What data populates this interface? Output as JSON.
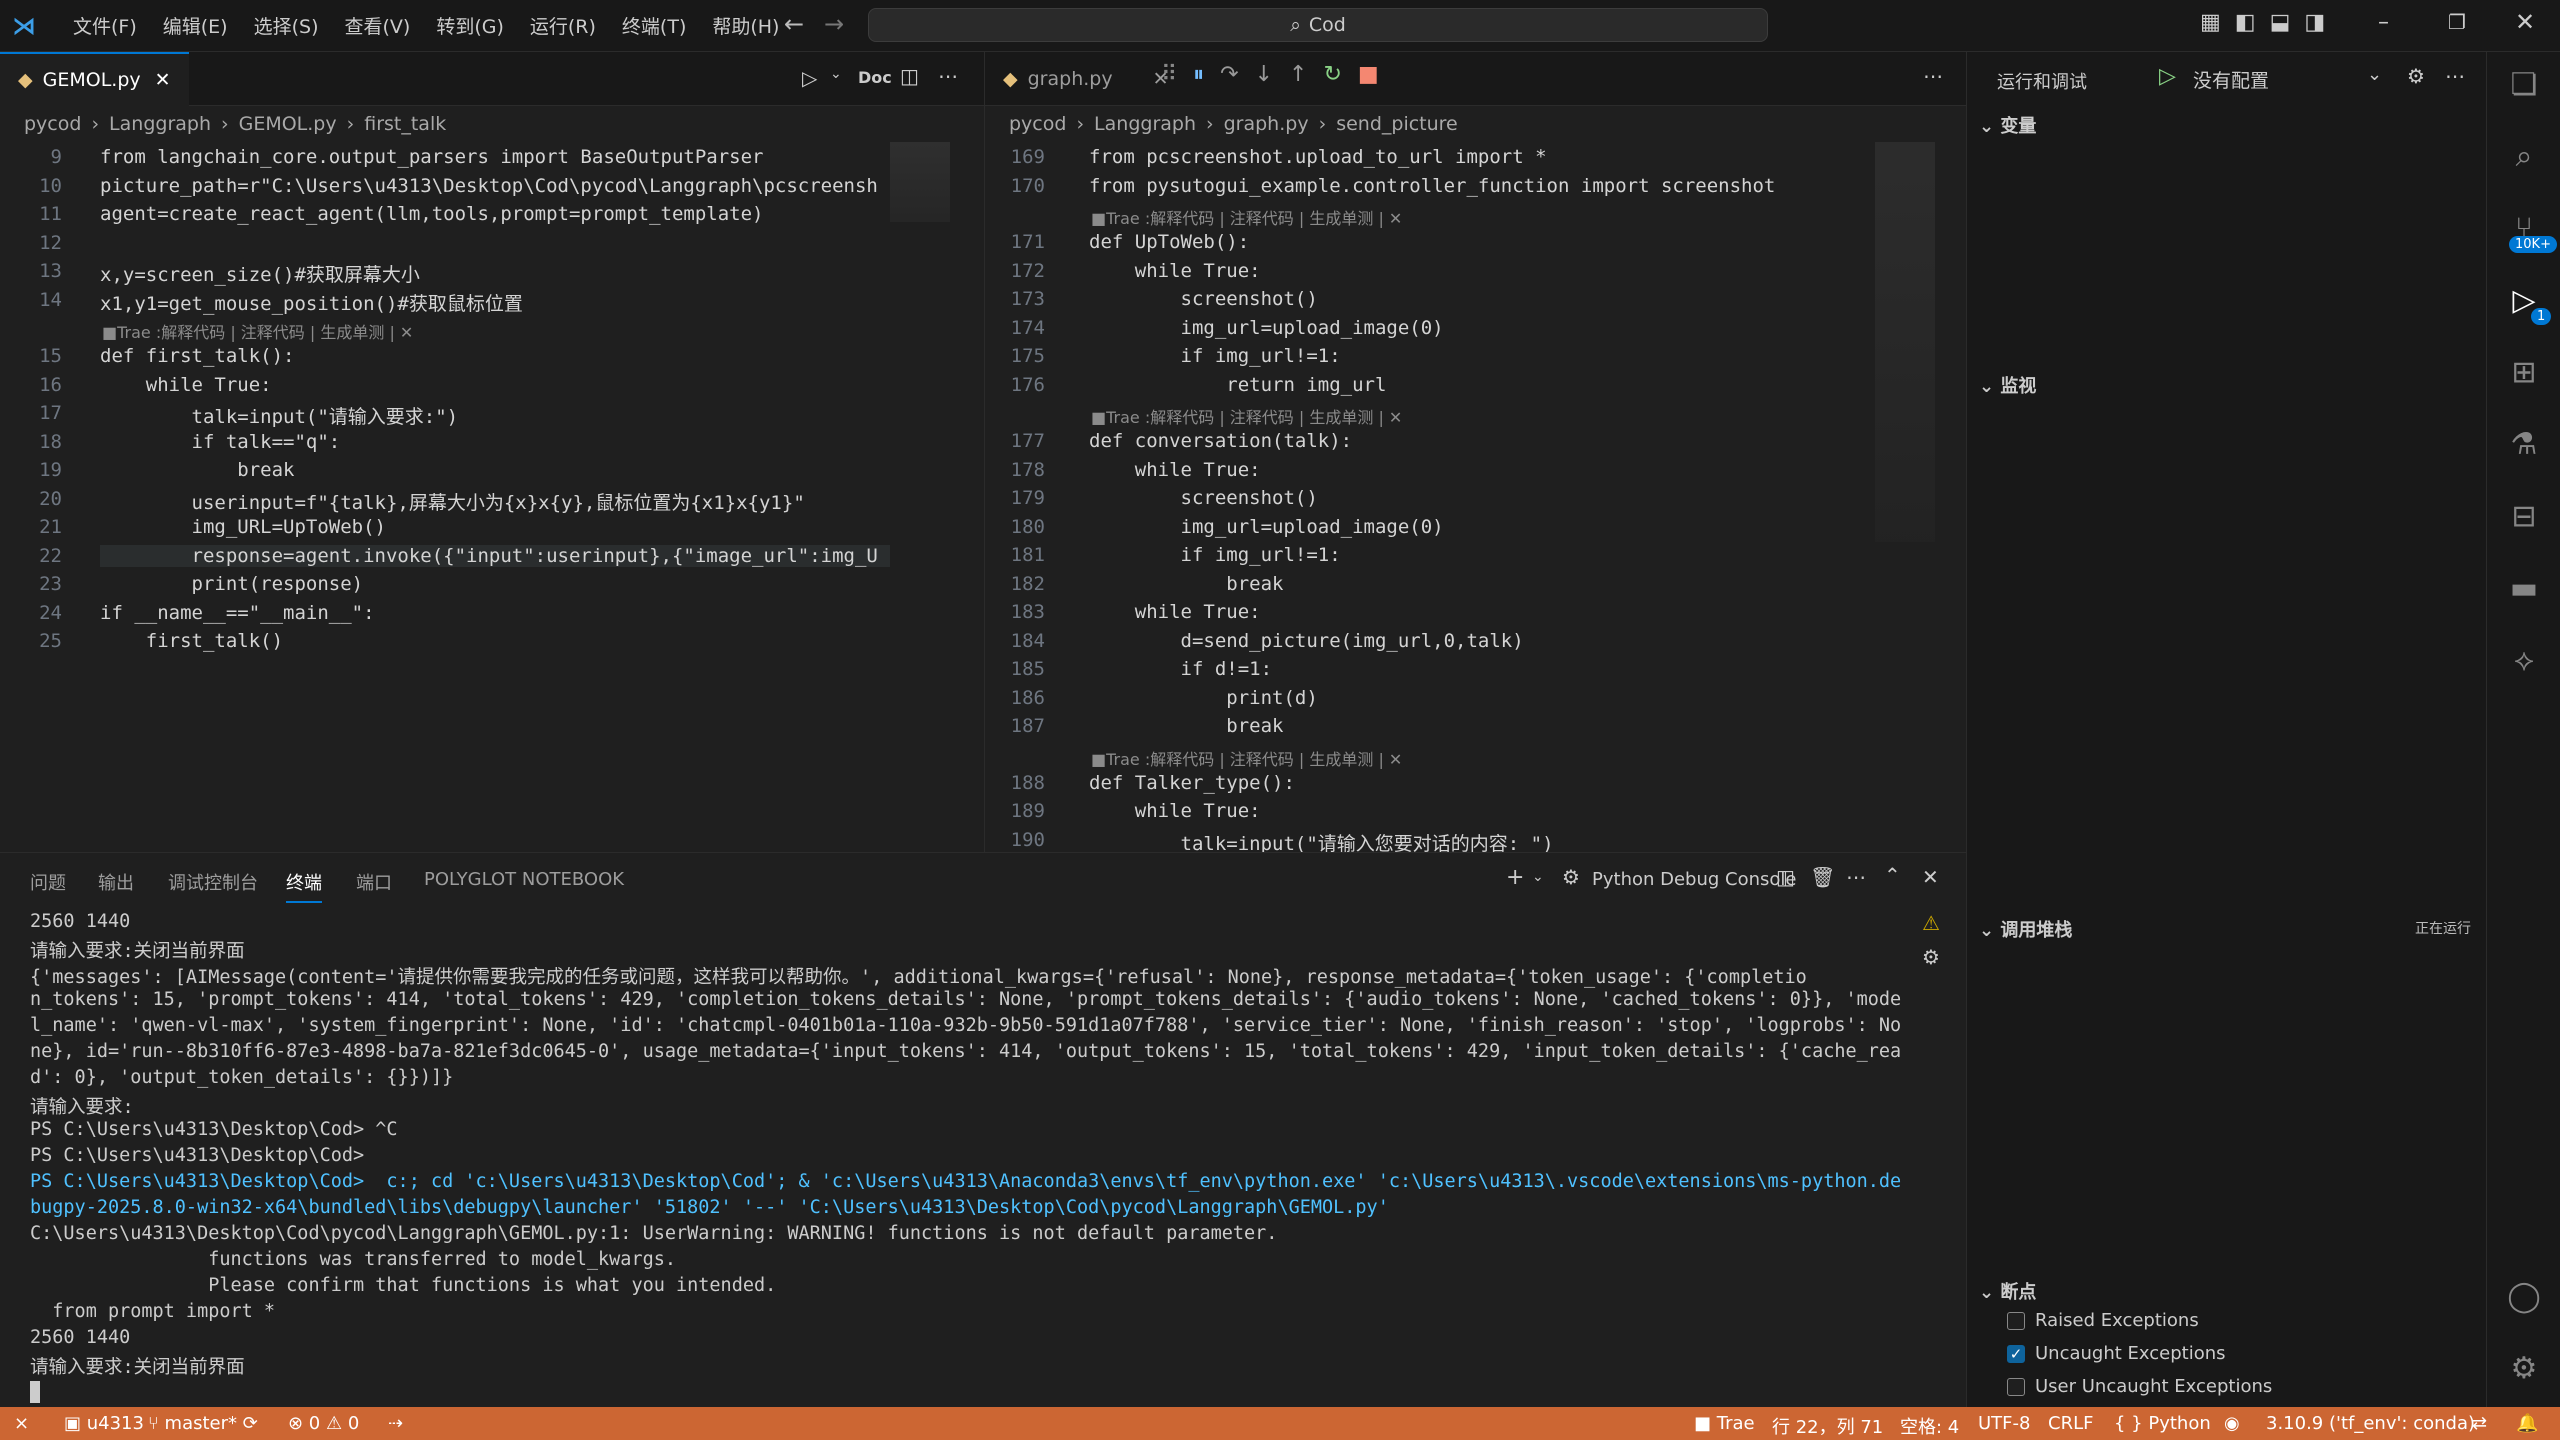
{
  "menu": [
    "文件(F)",
    "编辑(E)",
    "选择(S)",
    "查看(V)",
    "转到(G)",
    "运行(R)",
    "终端(T)",
    "帮助(H)"
  ],
  "search": "Cod",
  "left": {
    "tab": "GEMOL.py",
    "doc": "Doc",
    "crumbs": [
      "pycod",
      "Langgraph",
      "GEMOL.py",
      "first_talk"
    ],
    "lines": [
      [
        "9",
        "from langchain_core.output_parsers import BaseOutputParser"
      ],
      [
        "10",
        "picture_path=r\"C:\\Users\\u4313\\Desktop\\Cod\\pycod\\Langgraph\\pcscreensh"
      ],
      [
        "11",
        "agent=create_react_agent(llm,tools,prompt=prompt_template)"
      ],
      [
        "12",
        ""
      ],
      [
        "13",
        "x,y=screen_size()#获取屏幕大小"
      ],
      [
        "14",
        "x1,y1=get_mouse_position()#获取鼠标位置"
      ],
      [
        "15",
        "def first_talk():"
      ],
      [
        "16",
        "    while True:"
      ],
      [
        "17",
        "        talk=input(\"请输入要求:\")"
      ],
      [
        "18",
        "        if talk==\"q\":"
      ],
      [
        "19",
        "            break"
      ],
      [
        "20",
        "        userinput=f\"{talk},屏幕大小为{x}x{y},鼠标位置为{x1}x{y1}\""
      ],
      [
        "21",
        "        img_URL=UpToWeb()"
      ],
      [
        "22",
        "        response=agent.invoke({\"input\":userinput},{\"image_url\":img_U"
      ],
      [
        "23",
        "        print(response)"
      ],
      [
        "24",
        "if __name__==\"__main__\":"
      ],
      [
        "25",
        "    first_talk()"
      ]
    ],
    "lens": "■Trae :解释代码 | 注释代码 | 生成单测 | ✕"
  },
  "right": {
    "tab": "graph.py",
    "crumbs": [
      "pycod",
      "Langgraph",
      "graph.py",
      "send_picture"
    ],
    "lines": [
      [
        "169",
        "from pcscreenshot.upload_to_url import *"
      ],
      [
        "170",
        "from pysutogui_example.controller_function import screenshot"
      ],
      [
        "171",
        "def UpToWeb():"
      ],
      [
        "172",
        "    while True:"
      ],
      [
        "173",
        "        screenshot()"
      ],
      [
        "174",
        "        img_url=upload_image(0)"
      ],
      [
        "175",
        "        if img_url!=1:"
      ],
      [
        "176",
        "            return img_url"
      ],
      [
        "177",
        "def conversation(talk):"
      ],
      [
        "178",
        "    while True:"
      ],
      [
        "179",
        "        screenshot()"
      ],
      [
        "180",
        "        img_url=upload_image(0)"
      ],
      [
        "181",
        "        if img_url!=1:"
      ],
      [
        "182",
        "            break"
      ],
      [
        "183",
        "    while True:"
      ],
      [
        "184",
        "        d=send_picture(img_url,0,talk)"
      ],
      [
        "185",
        "        if d!=1:"
      ],
      [
        "186",
        "            print(d)"
      ],
      [
        "187",
        "            break"
      ],
      [
        "188",
        "def Talker_type():"
      ],
      [
        "189",
        "    while True:"
      ],
      [
        "190",
        "        talk=input(\"请输入您要对话的内容: \")"
      ]
    ]
  },
  "panel": {
    "tabs": [
      "问题",
      "输出",
      "调试控制台",
      "终端",
      "端口",
      "POLYGLOT NOTEBOOK"
    ],
    "console": "Python Debug Console",
    "term": [
      "2560 1440",
      "请输入要求:关闭当前界面",
      "{'messages': [AIMessage(content='请提供你需要我完成的任务或问题，这样我可以帮助你。', additional_kwargs={'refusal': None}, response_metadata={'token_usage': {'completio",
      "n_tokens': 15, 'prompt_tokens': 414, 'total_tokens': 429, 'completion_tokens_details': None, 'prompt_tokens_details': {'audio_tokens': None, 'cached_tokens': 0}}, 'mode",
      "l_name': 'qwen-vl-max', 'system_fingerprint': None, 'id': 'chatcmpl-0401b01a-110a-932b-9b50-591d1a07f788', 'service_tier': None, 'finish_reason': 'stop', 'logprobs': No",
      "ne}, id='run--8b310ff6-87e3-4898-ba7a-821ef3dc0645-0', usage_metadata={'input_tokens': 414, 'output_tokens': 15, 'total_tokens': 429, 'input_token_details': {'cache_rea",
      "d': 0}, 'output_token_details': {}})]}",
      "请输入要求:",
      "PS C:\\Users\\u4313\\Desktop\\Cod> ^C",
      "PS C:\\Users\\u4313\\Desktop\\Cod>",
      "PS C:\\Users\\u4313\\Desktop\\Cod>  c:; cd 'c:\\Users\\u4313\\Desktop\\Cod'; & 'c:\\Users\\u4313\\Anaconda3\\envs\\tf_env\\python.exe' 'c:\\Users\\u4313\\.vscode\\extensions\\ms-python.de",
      "bugpy-2025.8.0-win32-x64\\bundled\\libs\\debugpy\\launcher' '51802' '--' 'C:\\Users\\u4313\\Desktop\\Cod\\pycod\\Langgraph\\GEMOL.py'",
      "C:\\Users\\u4313\\Desktop\\Cod\\pycod\\Langgraph\\GEMOL.py:1: UserWarning: WARNING! functions is not default parameter.",
      "                functions was transferred to model_kwargs.",
      "                Please confirm that functions is what you intended.",
      "  from prompt import *",
      "2560 1440",
      "请输入要求:关闭当前界面"
    ]
  },
  "side": {
    "title": "运行和调试",
    "config": "没有配置",
    "variables": "变量",
    "watch": "监视",
    "callstack": "调用堆栈",
    "running": "正在运行",
    "breakpoints": "断点",
    "bp": [
      {
        "label": "Raised Exceptions",
        "on": false
      },
      {
        "label": "Uncaught Exceptions",
        "on": true
      },
      {
        "label": "User Uncaught Exceptions",
        "on": false
      }
    ]
  },
  "activity": {
    "badge1": "10K+",
    "badge2": "1"
  },
  "status": {
    "remote": "⨯",
    "user": "u4313",
    "branch": "master*",
    "errors": "⊗ 0 ⚠ 0",
    "trae": "Trae",
    "pos": "行 22，列 71",
    "spaces": "空格: 4",
    "enc": "UTF-8",
    "eol": "CRLF",
    "lang": "{ } Python",
    "py": "3.10.9 ('tf_env': conda)"
  },
  "colors": {
    "accent": "#cc6633",
    "bg": "#1f1f1f"
  }
}
